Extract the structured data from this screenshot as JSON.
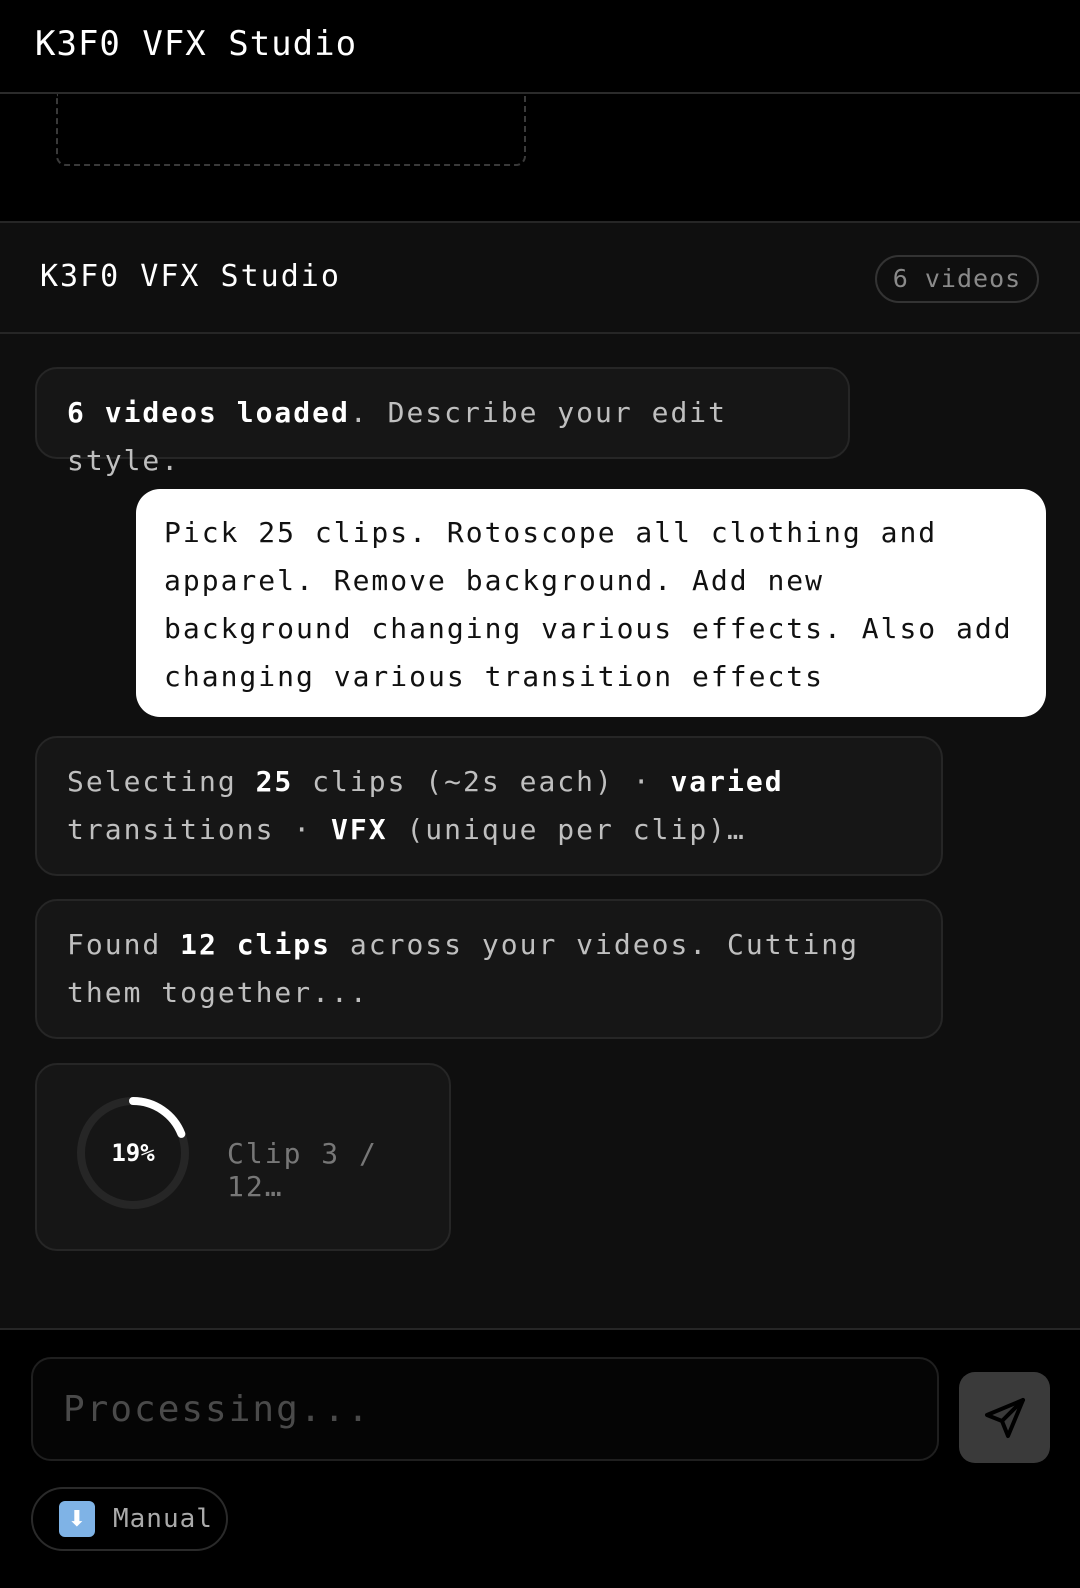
{
  "app": {
    "title": "K3F0 VFX Studio"
  },
  "panel": {
    "title": "K3F0 VFX Studio",
    "video_count": "6 videos"
  },
  "messages": {
    "system_1": {
      "bold": "6 videos loaded",
      "text": ". Describe your edit style."
    },
    "user_1": {
      "text": "Pick 25 clips. Rotoscope all clothing and apparel. Remove background. Add new background changing various effects. Also add changing various transition effects"
    },
    "system_2": {
      "p1": "Selecting ",
      "b1": "25",
      "p2": " clips (~2s each) · ",
      "b2": "varied",
      "p3": " transitions · ",
      "b3": "VFX",
      "p4": " (unique per clip)…"
    },
    "system_3": {
      "p1": "Found ",
      "b1": "12 clips",
      "p2": " across your videos. Cutting them together..."
    }
  },
  "progress": {
    "percent": 19,
    "percent_label": "19%",
    "status": "Clip 3 / 12…"
  },
  "composer": {
    "placeholder": "Processing...",
    "send_icon": "send-icon",
    "manual_label": "Manual",
    "manual_icon": "download-arrow-icon",
    "manual_icon_glyph": "⬇"
  },
  "colors": {
    "accent_ring": "#ffffff",
    "ring_track": "#262626",
    "manual_icon_bg": "#7fb3e6"
  }
}
